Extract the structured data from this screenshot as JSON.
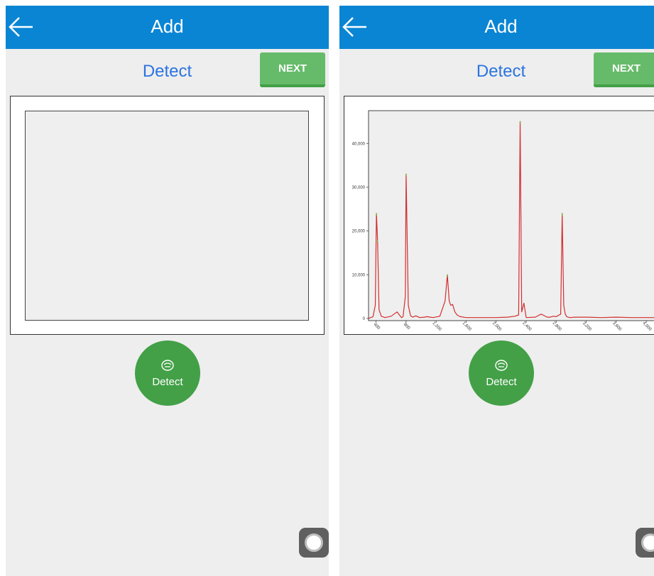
{
  "screens": [
    {
      "app_bar": {
        "title": "Add",
        "back_icon": "arrow-left-icon"
      },
      "header": {
        "title": "Detect"
      },
      "next_button": {
        "label": "NEXT"
      },
      "detect_button": {
        "label": "Detect",
        "icon": "ultrasound-probe-icon"
      },
      "floating_button": {
        "icon": "assistive-touch-icon"
      },
      "chart_state": "empty"
    },
    {
      "app_bar": {
        "title": "Add",
        "back_icon": "arrow-left-icon"
      },
      "header": {
        "title": "Detect"
      },
      "next_button": {
        "label": "NEXT"
      },
      "detect_button": {
        "label": "Detect",
        "icon": "ultrasound-probe-icon"
      },
      "floating_button": {
        "icon": "assistive-touch-icon"
      },
      "chart_state": "spectrum"
    }
  ],
  "chart_data": {
    "type": "line",
    "xlabel": "",
    "ylabel": "",
    "xlim": [
      300,
      4150
    ],
    "ylim": [
      -500,
      47500
    ],
    "x_ticks": [
      400,
      800,
      1200,
      1600,
      2000,
      2400,
      2800,
      3200,
      3600,
      4000
    ],
    "x_tick_labels": [
      "400",
      "800",
      "1,200",
      "1,600",
      "2,000",
      "2,400",
      "2,800",
      "3,200",
      "3,600",
      "4,000"
    ],
    "y_ticks": [
      0,
      10000,
      20000,
      30000,
      40000
    ],
    "y_tick_labels": [
      "0",
      "10,000",
      "20,000",
      "30,000",
      "40,000"
    ],
    "grid": false,
    "legend": "none",
    "series": [
      {
        "color": "#d32f2f",
        "peak_color": "#7cb342",
        "x": [
          300,
          360,
          390,
          405,
          420,
          440,
          470,
          520,
          600,
          680,
          720,
          740,
          760,
          790,
          800,
          830,
          860,
          890,
          930,
          980,
          1040,
          1080,
          1120,
          1160,
          1250,
          1320,
          1350,
          1375,
          1395,
          1420,
          1450,
          1480,
          1520,
          1600,
          1800,
          2000,
          2150,
          2250,
          2300,
          2320,
          2340,
          2370,
          2400,
          2520,
          2600,
          2680,
          2720,
          2760,
          2800,
          2860,
          2880,
          2900,
          2920,
          2940,
          2960,
          2980,
          3050,
          3200,
          3400,
          3600,
          3800,
          4000,
          4150
        ],
        "y": [
          0,
          400,
          3000,
          24000,
          18000,
          2000,
          500,
          200,
          500,
          1500,
          600,
          200,
          400,
          5000,
          33000,
          3000,
          600,
          300,
          600,
          200,
          300,
          400,
          300,
          200,
          500,
          4000,
          10000,
          4000,
          3000,
          3200,
          1500,
          800,
          400,
          200,
          200,
          200,
          300,
          500,
          800,
          45000,
          1500,
          3500,
          200,
          300,
          1000,
          300,
          300,
          500,
          400,
          1000,
          24000,
          3000,
          1000,
          400,
          300,
          200,
          300,
          300,
          200,
          300,
          200,
          200,
          200
        ]
      }
    ]
  }
}
